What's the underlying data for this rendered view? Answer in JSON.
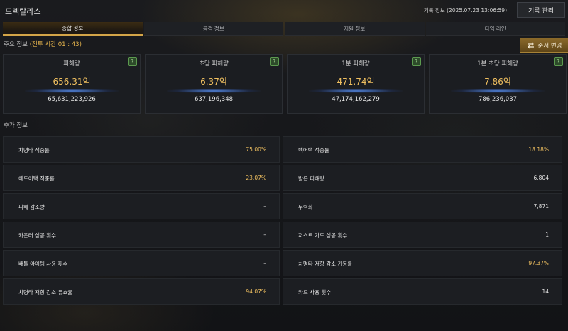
{
  "header": {
    "title": "드렉탈라스",
    "record_info": "기록 정보 (2025.07.23 13:06:59)",
    "manage_button": "기록 관리"
  },
  "tabs": [
    {
      "label": "종합 정보",
      "active": true
    },
    {
      "label": "공격 정보",
      "active": false
    },
    {
      "label": "지원 정보",
      "active": false
    },
    {
      "label": "타임 라인",
      "active": false
    }
  ],
  "main": {
    "section_label": "주요 정보",
    "battle_time": "(전투 시간 01 : 43)",
    "order_button": "순서 변경",
    "stats": [
      {
        "label": "피해량",
        "value": "656.31억",
        "raw": "65,631,223,926"
      },
      {
        "label": "초당 피해량",
        "value": "6.37억",
        "raw": "637,196,348"
      },
      {
        "label": "1분 피해량",
        "value": "471.74억",
        "raw": "47,174,162,279"
      },
      {
        "label": "1분 초당 피해량",
        "value": "7.86억",
        "raw": "786,236,037"
      }
    ]
  },
  "extra": {
    "section_label": "추가 정보",
    "rows": [
      {
        "key": "치명타 적중률",
        "value": "75.00%",
        "highlight": true
      },
      {
        "key": "백어택 적중률",
        "value": "18.18%",
        "highlight": true
      },
      {
        "key": "헤드어택 적중률",
        "value": "23.07%",
        "highlight": true
      },
      {
        "key": "받은 피해량",
        "value": "6,804",
        "highlight": false
      },
      {
        "key": "피해 감소량",
        "value": "–",
        "highlight": false
      },
      {
        "key": "무력화",
        "value": "7,871",
        "highlight": false
      },
      {
        "key": "카운터 성공 횟수",
        "value": "–",
        "highlight": false
      },
      {
        "key": "저스트 가드 성공 횟수",
        "value": "1",
        "highlight": false
      },
      {
        "key": "배틀 아이템 사용 횟수",
        "value": "–",
        "highlight": false
      },
      {
        "key": "치명타 저항 감소 가동률",
        "value": "97.37%",
        "highlight": true
      },
      {
        "key": "치명타 저항 감소 유효율",
        "value": "94.07%",
        "highlight": true
      },
      {
        "key": "카드 사용 횟수",
        "value": "14",
        "highlight": false
      }
    ]
  },
  "colors": {
    "accent_gold": "#f0c060",
    "help_green": "#5c9a4f"
  }
}
